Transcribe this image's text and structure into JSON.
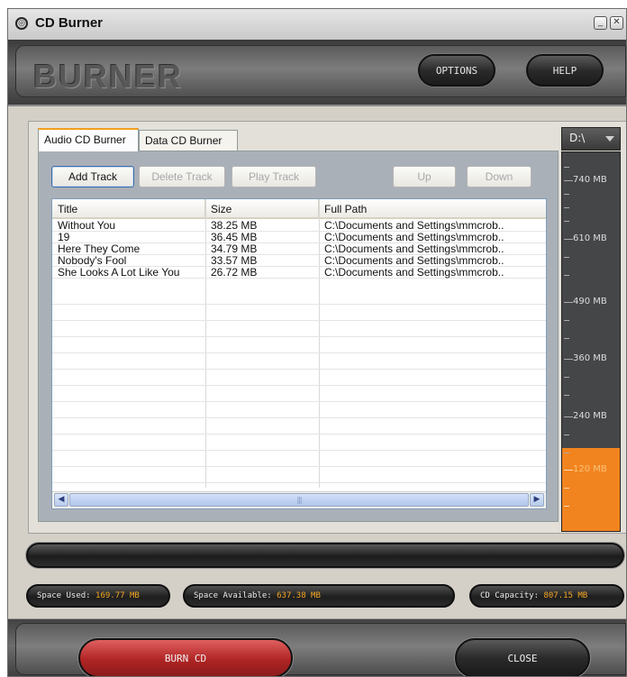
{
  "window": {
    "title": "CD Burner",
    "minimize_glyph": "_",
    "close_glyph": "✕"
  },
  "header": {
    "logo": "BURNER",
    "options_label": "OPTIONS",
    "help_label": "HELP"
  },
  "tabs": [
    {
      "label": "Audio CD Burner",
      "active": true
    },
    {
      "label": "Data CD Burner",
      "active": false
    }
  ],
  "toolbar": {
    "add_track": "Add Track",
    "delete_track": "Delete Track",
    "play_track": "Play Track",
    "up": "Up",
    "down": "Down"
  },
  "tracks": {
    "columns": [
      "Title",
      "Size",
      "Full Path"
    ],
    "rows": [
      {
        "title": "Without You",
        "size": "38.25 MB",
        "path": "C:\\Documents and Settings\\mmcrob.."
      },
      {
        "title": "19",
        "size": "36.45 MB",
        "path": "C:\\Documents and Settings\\mmcrob.."
      },
      {
        "title": "Here They Come",
        "size": "34.79 MB",
        "path": "C:\\Documents and Settings\\mmcrob.."
      },
      {
        "title": "Nobody's Fool",
        "size": "33.57 MB",
        "path": "C:\\Documents and Settings\\mmcrob.."
      },
      {
        "title": "She Looks A Lot Like You",
        "size": "26.72 MB",
        "path": "C:\\Documents and Settings\\mmcrob.."
      }
    ]
  },
  "drive": {
    "selected": "D:\\"
  },
  "capacity_meter": {
    "labels": [
      "740 MB",
      "610 MB",
      "490 MB",
      "360 MB",
      "240 MB",
      "120 MB"
    ],
    "fill_color": "#f2841f"
  },
  "status": {
    "space_used_label": "Space Used:",
    "space_used_value": "169.77 MB",
    "space_available_label": "Space Available:",
    "space_available_value": "637.38 MB",
    "cd_capacity_label": "CD Capacity:",
    "cd_capacity_value": "807.15 MB"
  },
  "footer": {
    "burn_label": "BURN CD",
    "close_label": "CLOSE"
  },
  "colors": {
    "accent_orange": "#f5a623",
    "burn_red": "#c83232"
  }
}
